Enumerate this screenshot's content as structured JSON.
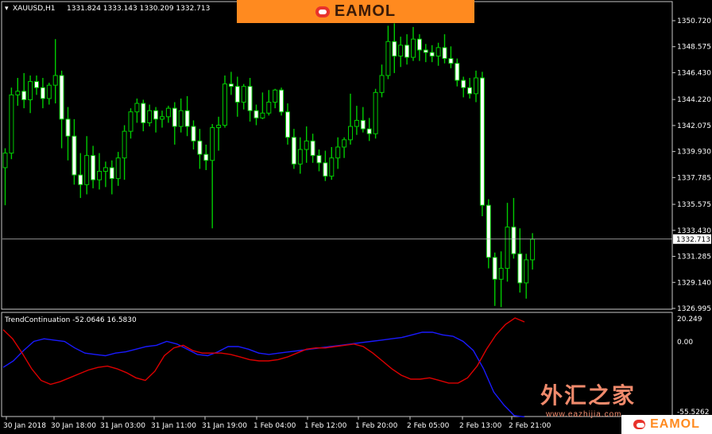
{
  "header": {
    "symbol": "XAUUSD,H1",
    "ohlc": "1331.824 1333.143 1330.209 1332.713"
  },
  "indicator": {
    "label": "TrendContinuation -52.0646 16.5830",
    "scale_top": "20.249",
    "scale_zero": "0.00",
    "scale_bottom": "-55.5262"
  },
  "current_price": "1332.713",
  "price_ticks": [
    "1350.720",
    "1348.575",
    "1346.430",
    "1344.220",
    "1342.075",
    "1339.930",
    "1337.785",
    "1335.575",
    "1333.430",
    "1331.285",
    "1329.140",
    "1326.995"
  ],
  "time_ticks": [
    "30 Jan 2018",
    "30 Jan 18:00",
    "31 Jan 03:00",
    "31 Jan 11:00",
    "31 Jan 19:00",
    "1 Feb 04:00",
    "1 Feb 12:00",
    "1 Feb 20:00",
    "2 Feb 05:00",
    "2 Feb 13:00",
    "2 Feb 21:00"
  ],
  "logo_top": "EAMOL",
  "logo_bottom": "EAMOL",
  "watermark_cn": "外汇之家",
  "watermark_url": "www.eazhijia.com",
  "colors": {
    "background": "#000000",
    "bull": "#ffffff",
    "bear_wick": "#00cc00",
    "line_red": "#dd0000",
    "line_blue": "#1a1aff",
    "logo_bg": "#ff8a1f"
  },
  "chart_data": [
    {
      "type": "candlestick",
      "title": "XAUUSD,H1",
      "ylim": [
        1326.995,
        1350.72
      ],
      "current": 1332.713,
      "candles": [
        [
          1338.6,
          1340.2,
          1335.5,
          1339.8
        ],
        [
          1339.8,
          1345.2,
          1339.3,
          1344.6
        ],
        [
          1344.6,
          1346.0,
          1343.7,
          1344.9
        ],
        [
          1344.9,
          1346.4,
          1343.5,
          1344.2
        ],
        [
          1344.2,
          1346.2,
          1343.1,
          1345.7
        ],
        [
          1345.7,
          1346.2,
          1344.6,
          1345.2
        ],
        [
          1345.2,
          1346.0,
          1343.5,
          1344.3
        ],
        [
          1344.3,
          1345.6,
          1343.8,
          1345.4
        ],
        [
          1345.4,
          1349.2,
          1343.9,
          1346.2
        ],
        [
          1346.2,
          1346.6,
          1340.2,
          1342.6
        ],
        [
          1342.6,
          1343.6,
          1339.2,
          1341.2
        ],
        [
          1341.2,
          1342.6,
          1337.2,
          1338.0
        ],
        [
          1338.0,
          1339.8,
          1336.1,
          1337.2
        ],
        [
          1337.2,
          1341.2,
          1336.4,
          1339.6
        ],
        [
          1339.6,
          1340.4,
          1336.9,
          1337.6
        ],
        [
          1337.6,
          1339.8,
          1336.8,
          1338.3
        ],
        [
          1338.3,
          1339.1,
          1337.0,
          1338.6
        ],
        [
          1338.6,
          1339.2,
          1336.4,
          1337.7
        ],
        [
          1337.7,
          1339.9,
          1337.1,
          1339.4
        ],
        [
          1339.4,
          1342.1,
          1337.6,
          1341.6
        ],
        [
          1341.6,
          1343.5,
          1341.0,
          1343.2
        ],
        [
          1343.2,
          1344.3,
          1342.3,
          1343.9
        ],
        [
          1343.9,
          1344.2,
          1341.6,
          1342.3
        ],
        [
          1342.3,
          1343.8,
          1342.0,
          1343.3
        ],
        [
          1343.3,
          1343.6,
          1341.5,
          1342.6
        ],
        [
          1342.6,
          1343.3,
          1341.9,
          1342.8
        ],
        [
          1342.8,
          1343.7,
          1342.3,
          1343.5
        ],
        [
          1343.5,
          1344.0,
          1340.5,
          1342.0
        ],
        [
          1342.0,
          1344.3,
          1341.5,
          1343.3
        ],
        [
          1343.3,
          1344.5,
          1341.2,
          1342.0
        ],
        [
          1342.0,
          1342.5,
          1340.1,
          1340.8
        ],
        [
          1340.8,
          1341.8,
          1338.5,
          1339.7
        ],
        [
          1339.7,
          1340.5,
          1338.4,
          1339.2
        ],
        [
          1339.2,
          1342.2,
          1333.6,
          1341.9
        ],
        [
          1341.9,
          1342.8,
          1340.0,
          1342.1
        ],
        [
          1342.1,
          1346.2,
          1341.9,
          1345.5
        ],
        [
          1345.5,
          1346.5,
          1344.6,
          1345.3
        ],
        [
          1345.3,
          1346.1,
          1342.8,
          1344.0
        ],
        [
          1344.0,
          1345.5,
          1343.4,
          1345.3
        ],
        [
          1345.3,
          1346.0,
          1342.4,
          1343.3
        ],
        [
          1343.3,
          1343.8,
          1342.1,
          1342.7
        ],
        [
          1342.7,
          1344.8,
          1342.6,
          1343.1
        ],
        [
          1343.1,
          1345.0,
          1342.9,
          1344.0
        ],
        [
          1344.0,
          1345.1,
          1343.5,
          1345.0
        ],
        [
          1345.0,
          1345.2,
          1342.9,
          1343.2
        ],
        [
          1343.2,
          1343.9,
          1340.5,
          1341.1
        ],
        [
          1341.1,
          1341.8,
          1338.5,
          1338.9
        ],
        [
          1338.9,
          1341.1,
          1338.1,
          1340.1
        ],
        [
          1340.1,
          1342.0,
          1339.0,
          1340.8
        ],
        [
          1340.8,
          1341.4,
          1339.0,
          1339.6
        ],
        [
          1339.6,
          1340.1,
          1338.3,
          1339.0
        ],
        [
          1339.0,
          1340.0,
          1337.5,
          1337.9
        ],
        [
          1337.9,
          1340.3,
          1337.6,
          1339.4
        ],
        [
          1339.4,
          1341.1,
          1338.5,
          1340.3
        ],
        [
          1340.3,
          1341.1,
          1339.4,
          1340.9
        ],
        [
          1340.9,
          1344.7,
          1340.5,
          1342.0
        ],
        [
          1342.0,
          1343.7,
          1341.3,
          1342.5
        ],
        [
          1342.5,
          1343.6,
          1341.5,
          1341.8
        ],
        [
          1341.8,
          1342.7,
          1340.8,
          1341.4
        ],
        [
          1341.4,
          1345.1,
          1341.0,
          1344.8
        ],
        [
          1344.8,
          1347.1,
          1344.4,
          1346.2
        ],
        [
          1346.2,
          1350.3,
          1345.9,
          1349.0
        ],
        [
          1349.0,
          1350.5,
          1346.4,
          1347.8
        ],
        [
          1347.8,
          1349.4,
          1346.9,
          1348.7
        ],
        [
          1348.7,
          1349.6,
          1347.1,
          1347.7
        ],
        [
          1347.7,
          1350.2,
          1347.4,
          1349.2
        ],
        [
          1349.2,
          1349.6,
          1347.4,
          1348.3
        ],
        [
          1348.3,
          1348.8,
          1347.3,
          1348.1
        ],
        [
          1348.1,
          1348.7,
          1347.3,
          1347.8
        ],
        [
          1347.8,
          1348.9,
          1347.0,
          1348.5
        ],
        [
          1348.5,
          1349.6,
          1347.2,
          1347.6
        ],
        [
          1347.6,
          1348.6,
          1346.8,
          1347.2
        ],
        [
          1347.2,
          1347.6,
          1345.3,
          1345.8
        ],
        [
          1345.8,
          1346.1,
          1344.4,
          1345.2
        ],
        [
          1345.2,
          1346.0,
          1344.3,
          1344.7
        ],
        [
          1344.7,
          1346.6,
          1344.0,
          1346.0
        ],
        [
          1346.0,
          1346.5,
          1334.6,
          1335.5
        ],
        [
          1335.5,
          1336.0,
          1330.3,
          1331.2
        ],
        [
          1331.2,
          1331.6,
          1327.2,
          1329.4
        ],
        [
          1329.4,
          1331.7,
          1327.1,
          1330.3
        ],
        [
          1330.3,
          1335.7,
          1329.2,
          1333.7
        ],
        [
          1333.7,
          1336.1,
          1331.1,
          1331.5
        ],
        [
          1331.5,
          1333.6,
          1328.3,
          1329.1
        ],
        [
          1329.1,
          1331.5,
          1327.8,
          1331.0
        ],
        [
          1331.0,
          1333.2,
          1330.2,
          1332.7
        ]
      ]
    },
    {
      "type": "line",
      "title": "TrendContinuation -52.0646 16.5830",
      "ylim": [
        -55.5262,
        20.249
      ],
      "series": [
        {
          "values": [
            -19,
            -14,
            -6,
            1,
            3,
            2,
            1,
            -4,
            -8,
            -9,
            -10,
            -8,
            -7,
            -5,
            -3,
            -2,
            1,
            -1,
            -5,
            -9,
            -10,
            -7,
            -3,
            -3,
            -5,
            -8,
            -9,
            -8,
            -7,
            -6,
            -5,
            -4,
            -3,
            -2,
            -1,
            0,
            1,
            2,
            3,
            4,
            6,
            8,
            8,
            6,
            5,
            1,
            -6,
            -20,
            -38,
            -48,
            -56,
            -57
          ]
        },
        {
          "values": [
            10,
            3,
            -8,
            -20,
            -29,
            -32,
            -30,
            -27,
            -24,
            -21,
            -19,
            -18,
            -20,
            -23,
            -27,
            -29,
            -22,
            -10,
            -4,
            -2,
            -6,
            -8,
            -8,
            -8,
            -9,
            -11,
            -13,
            -14,
            -14,
            -13,
            -11,
            -8,
            -5,
            -4,
            -4,
            -3,
            -2,
            -1,
            -3,
            -8,
            -14,
            -20,
            -25,
            -28,
            -28,
            -27,
            -29,
            -31,
            -31,
            -27,
            -18,
            -5,
            6,
            14,
            19,
            16
          ]
        }
      ]
    }
  ]
}
